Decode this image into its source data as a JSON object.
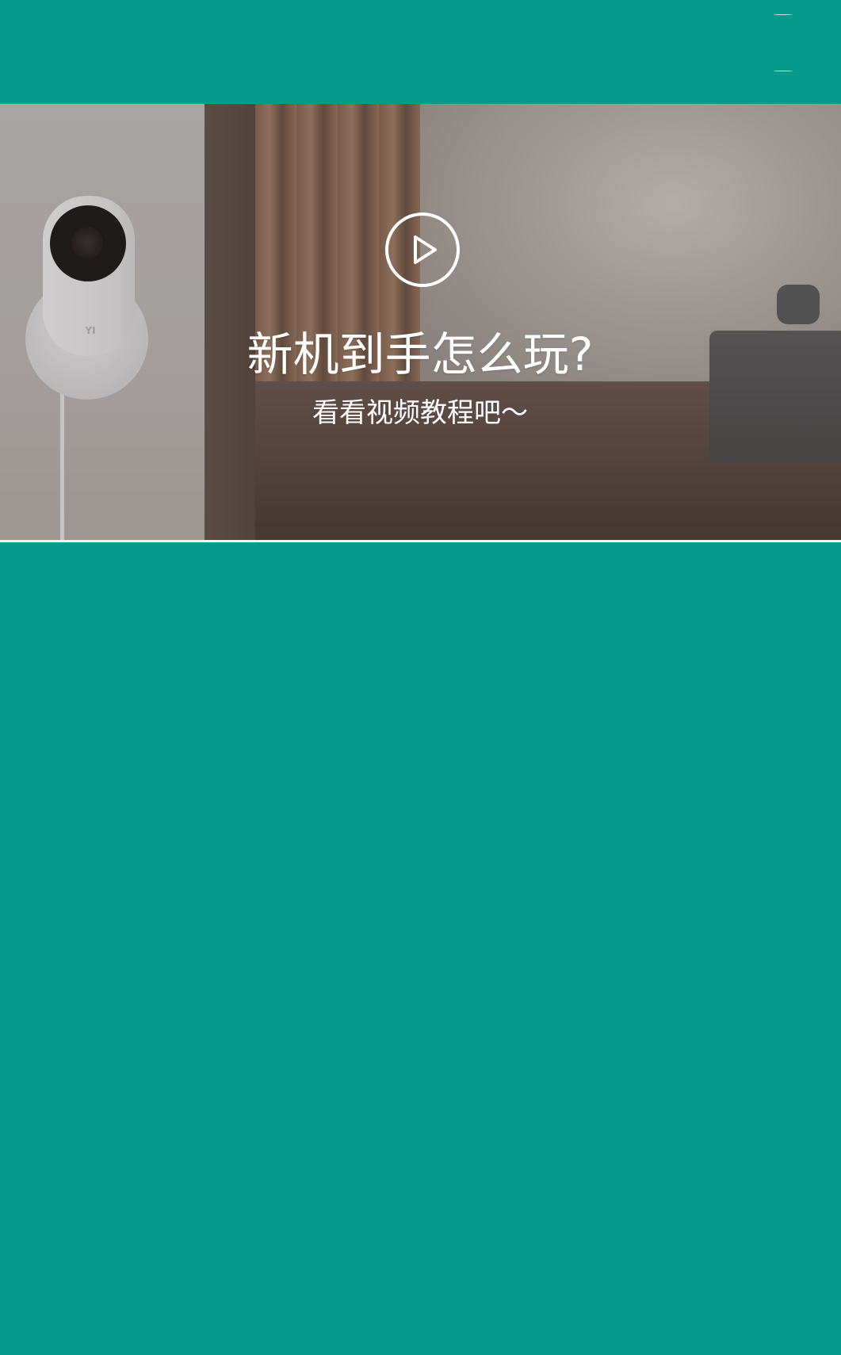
{
  "colors": {
    "accent": "#059B8B",
    "banner_text": "#FFFFFF"
  },
  "header": {
    "menu_icon": "menu-icon"
  },
  "banner": {
    "play_icon": "play-icon",
    "headline": "新机到手怎么玩?",
    "subheadline": "看看视频教程吧～",
    "camera_logo": "YI"
  }
}
